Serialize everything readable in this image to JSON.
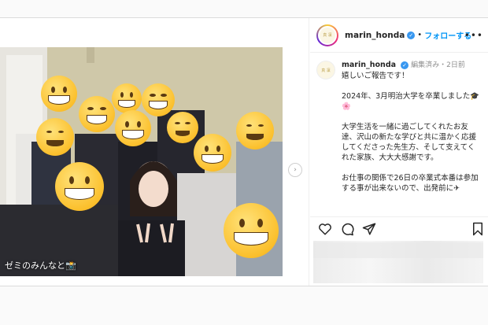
{
  "post": {
    "image_caption": "ゼミのみんなと📸",
    "next_arrow": "›"
  },
  "header": {
    "username": "marin_honda",
    "verified_mark": "✓",
    "separator": "•",
    "follow_label": "フォローする",
    "more_label": "•••",
    "avatar_text": "真 凜"
  },
  "comment": {
    "username": "marin_honda",
    "meta": "編集済み・2日前",
    "avatar_text": "真 凜",
    "paragraphs": [
      "嬉しいご報告です！",
      "2024年、3月明治大学を卒業しました🎓🌸",
      "大学生活を一緒に過ごしてくれたお友達、沢山の新たな学びと共に温かく応援してくださった先生方、そして支えてくれた家族、大大大感謝です。",
      "お仕事の関係で26日の卒業式本番は参加する事が出来ないので、出発前に✈"
    ]
  },
  "actions": {
    "like_icon": "heart-icon",
    "comment_icon": "comment-icon",
    "share_icon": "share-icon",
    "save_icon": "bookmark-icon"
  },
  "colors": {
    "accent": "#0095f6",
    "verified": "#3897f0",
    "text": "#262626",
    "muted": "#8e8e8e"
  }
}
